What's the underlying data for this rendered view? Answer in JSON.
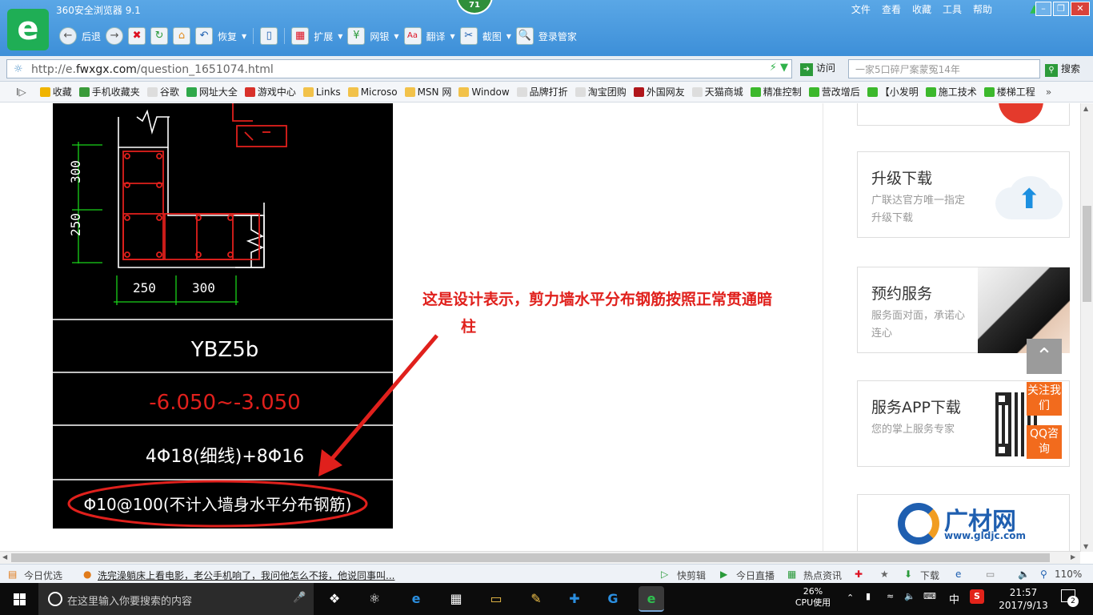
{
  "browser": {
    "title": "360安全浏览器 9.1",
    "notification_count": "71",
    "menu": [
      "文件",
      "查看",
      "收藏",
      "工具",
      "帮助"
    ],
    "toolbar": {
      "back": "后退",
      "restore": "恢复",
      "extensions": "扩展",
      "bank": "网银",
      "translate": "翻译",
      "screenshot": "截图",
      "login_manager": "登录管家"
    },
    "address": {
      "url_prefix": "http://e.",
      "url_domain": "fwxgx.com",
      "url_path": "/question_1651074.html",
      "visit": "访问",
      "search_placeholder": "一家5口碎尸案蒙冤14年",
      "search": "搜索"
    },
    "bookmarks": [
      {
        "label": "收藏",
        "color": "#f0b400"
      },
      {
        "label": "手机收藏夹",
        "color": "#3a9b3a"
      },
      {
        "label": "谷歌",
        "color": "#dddddd"
      },
      {
        "label": "网址大全",
        "color": "#2fa84a"
      },
      {
        "label": "游戏中心",
        "color": "#d8312a"
      },
      {
        "label": "Links",
        "color": "#f2c24a"
      },
      {
        "label": "Microso",
        "color": "#f2c24a"
      },
      {
        "label": "MSN 网",
        "color": "#f2c24a"
      },
      {
        "label": "Window",
        "color": "#f2c24a"
      },
      {
        "label": "品牌打折",
        "color": "#dddddd"
      },
      {
        "label": "淘宝团购",
        "color": "#dddddd"
      },
      {
        "label": "外国网友",
        "color": "#b0161b"
      },
      {
        "label": "天猫商城",
        "color": "#dddddd"
      },
      {
        "label": "精准控制",
        "color": "#3cb82c"
      },
      {
        "label": "营改增后",
        "color": "#3cb82c"
      },
      {
        "label": "【小发明",
        "color": "#3cb82c"
      },
      {
        "label": "施工技术",
        "color": "#3cb82c"
      },
      {
        "label": "楼梯工程",
        "color": "#3cb82c"
      }
    ]
  },
  "cad": {
    "dim_300_v": "300",
    "dim_250_v": "250",
    "dim_250_h": "250",
    "dim_300_h": "300",
    "name": "YBZ5b",
    "elevation": "-6.050~-3.050",
    "main_bars": "4Φ18(细线)+8Φ16",
    "stirrups": "Φ10@100(不计入墙身水平分布钢筋)"
  },
  "annotation": {
    "line1": "这是设计表示，剪力墙水平分布钢筋按照正常贯通暗",
    "line2": "柱"
  },
  "sidebar": {
    "cards": [
      {
        "title": "升级下载",
        "desc": "广联达官方唯一指定升级下载"
      },
      {
        "title": "预约服务",
        "desc": "服务面对面，承诺心连心"
      },
      {
        "title": "服务APP下载",
        "desc": "您的掌上服务专家"
      }
    ],
    "float_follow": "关注我们",
    "float_qq": "QQ咨询",
    "logo_text": "广材网",
    "logo_sub": "www.gldjc.com"
  },
  "statusbar": {
    "today_pick": "今日优选",
    "news": "洗完澡躺床上看电影，老公手机响了，我问他怎么不接，他说同事叫...",
    "quick_clip": "快剪辑",
    "live": "今日直播",
    "hot_news": "热点资讯",
    "download": "下载",
    "zoom": "110%"
  },
  "taskbar": {
    "search_placeholder": "在这里输入你要搜索的内容",
    "cpu_percent": "26%",
    "cpu_label": "CPU使用",
    "ime": "中",
    "time": "21:57",
    "date": "2017/9/13",
    "notifications": "2"
  }
}
